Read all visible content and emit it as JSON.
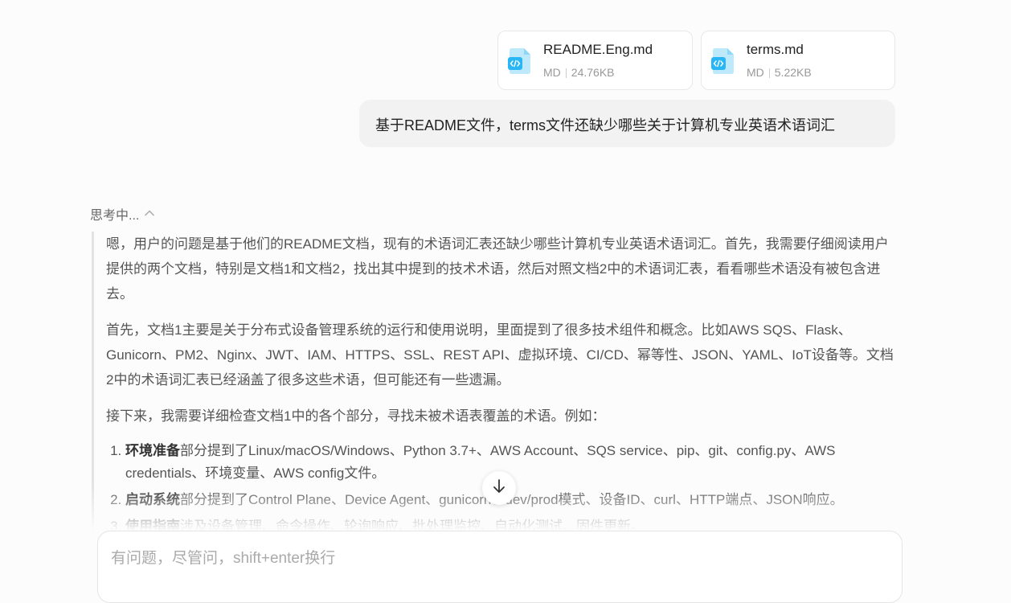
{
  "attachments": [
    {
      "name": "README.Eng.md",
      "type": "MD",
      "size": "24.76KB"
    },
    {
      "name": "terms.md",
      "type": "MD",
      "size": "5.22KB"
    }
  ],
  "user_message": "基于README文件，terms文件还缺少哪些关于计算机专业英语术语词汇",
  "thinking": {
    "label": "思考中...",
    "paragraphs": [
      "嗯，用户的问题是基于他们的README文档，现有的术语词汇表还缺少哪些计算机专业英语术语词汇。首先，我需要仔细阅读用户提供的两个文档，特别是文档1和文档2，找出其中提到的技术术语，然后对照文档2中的术语词汇表，看看哪些术语没有被包含进去。",
      "首先，文档1主要是关于分布式设备管理系统的运行和使用说明，里面提到了很多技术组件和概念。比如AWS SQS、Flask、Gunicorn、PM2、Nginx、JWT、IAM、HTTPS、SSL、REST API、虚拟环境、CI/CD、幂等性、JSON、YAML、IoT设备等。文档2中的术语词汇表已经涵盖了很多这些术语，但可能还有一些遗漏。",
      "接下来，我需要详细检查文档1中的各个部分，寻找未被术语表覆盖的术语。例如："
    ],
    "list": [
      {
        "bold": "环境准备",
        "text": "部分提到了Linux/macOS/Windows、Python 3.7+、AWS Account、SQS service、pip、git、config.py、AWS credentials、环境变量、AWS config文件。"
      },
      {
        "bold": "启动系统",
        "text": "部分提到了Control Plane、Device Agent、gunicorn、dev/prod模式、设备ID、curl、HTTP端点、JSON响应。"
      },
      {
        "bold": "使用指南",
        "text": "涉及设备管理、命令操作、轮询响应、批处理监控、自动化测试、固件更新。"
      }
    ]
  },
  "input": {
    "placeholder": "有问题，尽管问，shift+enter换行"
  },
  "colors": {
    "file_icon": "#29b6f6",
    "user_bubble": "#f2f2f2"
  }
}
